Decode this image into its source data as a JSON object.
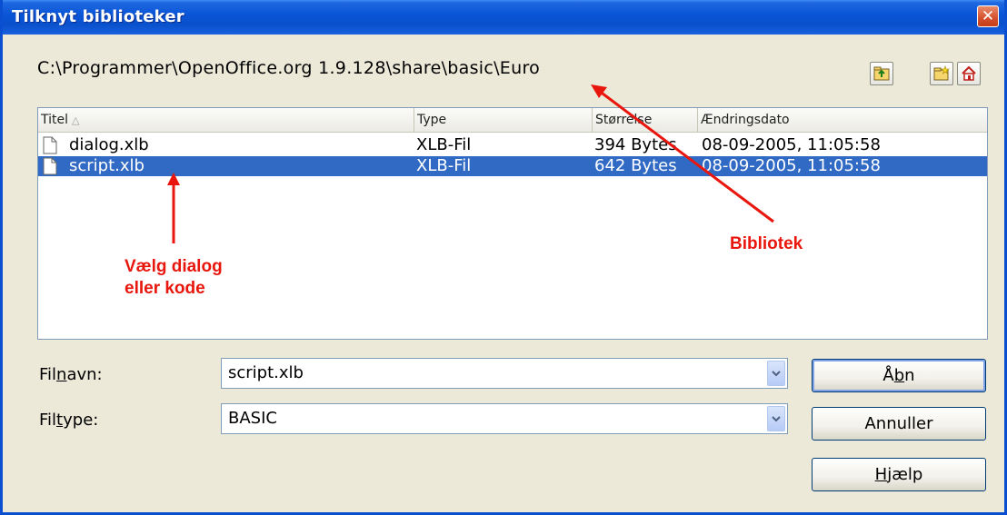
{
  "window": {
    "title": "Tilknyt biblioteker",
    "close_glyph": "✕"
  },
  "path": {
    "value": "C:\\Programmer\\OpenOffice.org 1.9.128\\share\\basic\\Euro"
  },
  "toolbar": {
    "buttons": [
      {
        "icon": "folder-up-icon"
      },
      {
        "icon": "new-folder-icon"
      },
      {
        "icon": "home-icon"
      }
    ]
  },
  "file_list": {
    "columns": {
      "title": "Titel",
      "type": "Type",
      "size": "Størrelse",
      "modified": "Ændringsdato"
    },
    "sort_glyph": "△",
    "rows": [
      {
        "name": "dialog.xlb",
        "type": "XLB-Fil",
        "size": "394 Bytes",
        "modified": "08-09-2005, 11:05:58",
        "selected": false
      },
      {
        "name": "script.xlb",
        "type": "XLB-Fil",
        "size": "642 Bytes",
        "modified": "08-09-2005, 11:05:58",
        "selected": true
      }
    ]
  },
  "filename": {
    "label_pre": "Fil",
    "label_key": "n",
    "label_post": "avn:",
    "value": "script.xlb"
  },
  "filetype": {
    "label_pre": "Fil",
    "label_key": "t",
    "label_post": "ype:",
    "value": "BASIC"
  },
  "buttons": {
    "open": {
      "pre": "Å",
      "key": "b",
      "post": "n"
    },
    "cancel": {
      "label": "Annuller"
    },
    "help": {
      "pre": "",
      "key": "H",
      "post": "jælp"
    }
  },
  "annotations": {
    "choose_line1": "Vælg dialog",
    "choose_line2": "eller kode",
    "library": "Bibliotek",
    "color": "#e8160c"
  },
  "colors": {
    "titlebar": "#0a56d8",
    "selection": "#316ac5",
    "dialog_bg": "#ece9d8"
  }
}
